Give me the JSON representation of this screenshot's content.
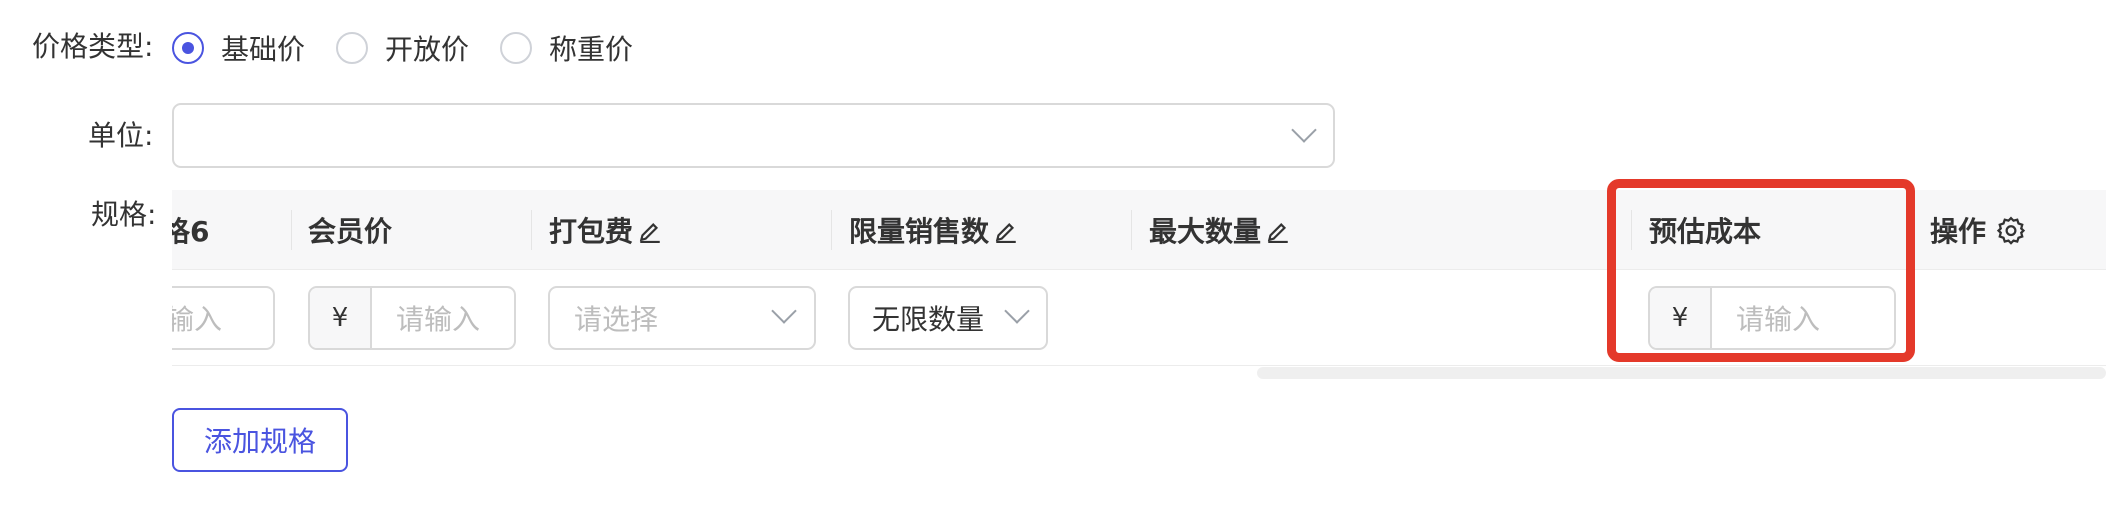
{
  "form": {
    "price_type_label": "价格类型:",
    "price_types": [
      {
        "label": "基础价",
        "checked": true
      },
      {
        "label": "开放价",
        "checked": false
      },
      {
        "label": "称重价",
        "checked": false
      }
    ],
    "unit_label": "单位:",
    "spec_label": "规格:",
    "add_spec_button": "添加规格"
  },
  "table": {
    "columns": {
      "partial": "格6",
      "member_price": "会员价",
      "packing_fee": "打包费",
      "limit_sales": "限量销售数",
      "max_qty": "最大数量",
      "est_cost": "预估成本",
      "action": "操作"
    },
    "row": {
      "partial_placeholder": "请输入",
      "currency_symbol": "¥",
      "member_price_placeholder": "请输入",
      "packing_fee_placeholder": "请选择",
      "limit_sales_value": "无限数量",
      "est_cost_placeholder": "请输入"
    }
  },
  "colors": {
    "accent": "#4a54e0",
    "highlight": "#e4392a"
  }
}
